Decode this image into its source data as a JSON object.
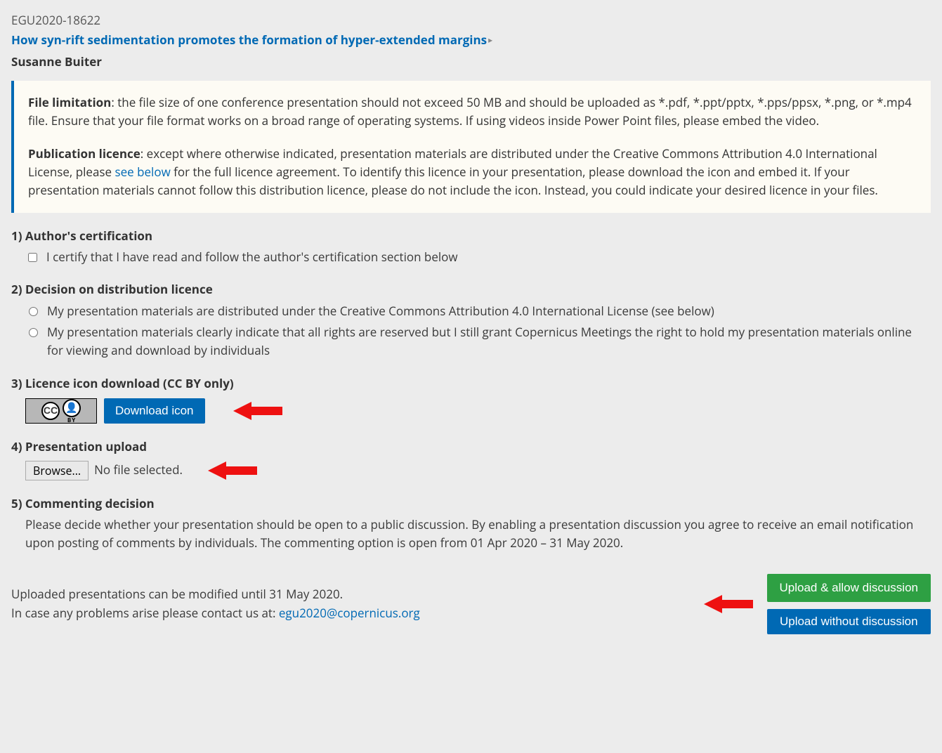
{
  "header": {
    "id": "EGU2020-18622",
    "title": "How syn-rift sedimentation promotes the formation of hyper-extended margins",
    "author": "Susanne Buiter"
  },
  "info": {
    "file_limitation_label": "File limitation",
    "file_limitation_text": ": the file size of one conference presentation should not exceed 50 MB and should be uploaded as *.pdf, *.ppt/pptx, *.pps/ppsx, *.png, or *.mp4 file. Ensure that your file format works on a broad range of operating systems. If using videos inside Power Point files, please embed the video.",
    "pub_licence_label": "Publication licence",
    "pub_licence_text_a": ": except where otherwise indicated, presentation materials are distributed under the Creative Commons Attribution 4.0 International License, please ",
    "see_below": "see below",
    "pub_licence_text_b": " for the full licence agreement. To identify this licence in your presentation, please download the icon and embed it. If your presentation materials cannot follow this distribution licence, please do not include the icon. Instead, you could indicate your desired licence in your files."
  },
  "s1": {
    "head": "1) Author's certification",
    "check_label": "I certify that I have read and follow the author's certification section below"
  },
  "s2": {
    "head": "2) Decision on distribution licence",
    "opt1": "My presentation materials are distributed under the Creative Commons Attribution 4.0 International License (see below)",
    "opt2": "My presentation materials clearly indicate that all rights are reserved but I still grant Copernicus Meetings the right to hold my presentation materials online for viewing and download by individuals"
  },
  "s3": {
    "head": "3) Licence icon download (CC BY only)",
    "download_btn": "Download icon"
  },
  "s4": {
    "head": "4) Presentation upload",
    "browse": "Browse...",
    "no_file": "No file selected."
  },
  "s5": {
    "head": "5) Commenting decision",
    "text": "Please decide whether your presentation should be open to a public discussion. By enabling a presentation discussion you agree to receive an email notification upon posting of comments by individuals. The commenting option is open from 01 Apr 2020 – 31 May 2020."
  },
  "footer": {
    "line1": "Uploaded presentations can be modified until 31 May 2020.",
    "line2a": "In case any problems arise please contact us at: ",
    "email": "egu2020@copernicus.org",
    "btn_green": "Upload & allow discussion",
    "btn_blue": "Upload without discussion"
  }
}
